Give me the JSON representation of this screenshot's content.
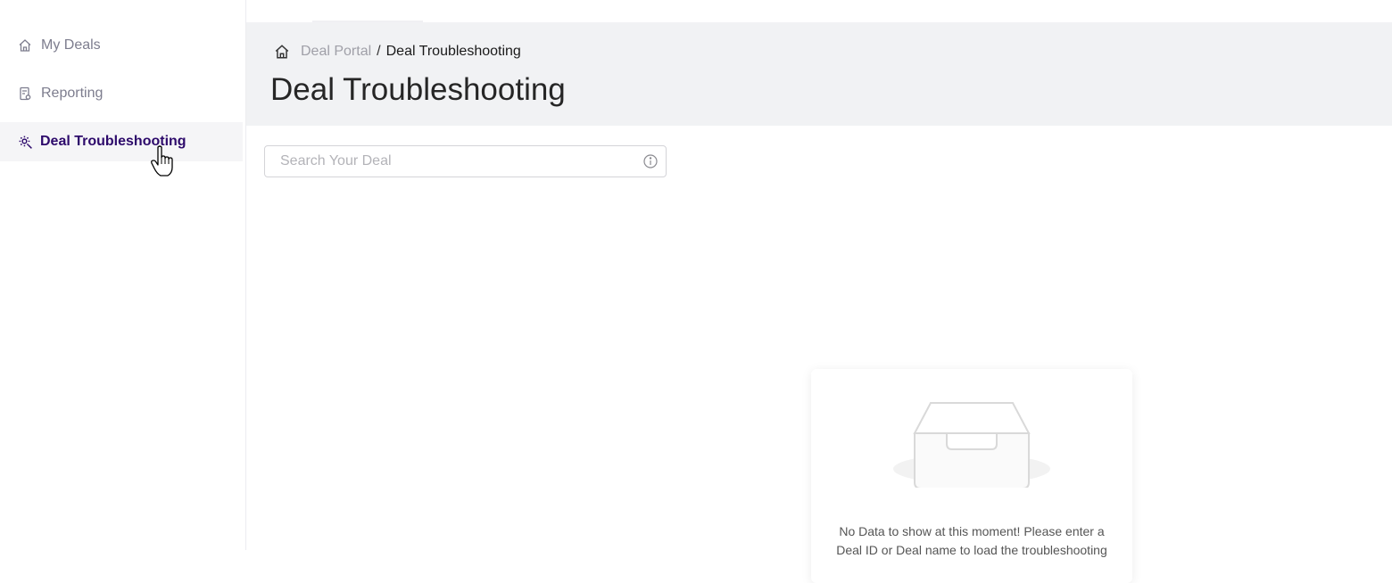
{
  "sidebar": {
    "items": [
      {
        "label": "My Deals",
        "icon": "home-icon",
        "active": false
      },
      {
        "label": "Reporting",
        "icon": "report-icon",
        "active": false
      },
      {
        "label": "Deal Troubleshooting",
        "icon": "gear-search-icon",
        "active": true
      }
    ]
  },
  "header": {
    "breadcrumb": {
      "root": "Deal Portal",
      "separator": "/",
      "current": "Deal Troubleshooting"
    },
    "title": "Deal Troubleshooting"
  },
  "search": {
    "placeholder": "Search Your Deal",
    "value": ""
  },
  "empty_state": {
    "message": "No Data to show at this moment! Please enter a Deal ID or Deal name to load the troubleshooting"
  },
  "colors": {
    "accent": "#2d0a6b",
    "header_bg": "#f1f2f4",
    "muted_text": "#7d7d8e"
  }
}
